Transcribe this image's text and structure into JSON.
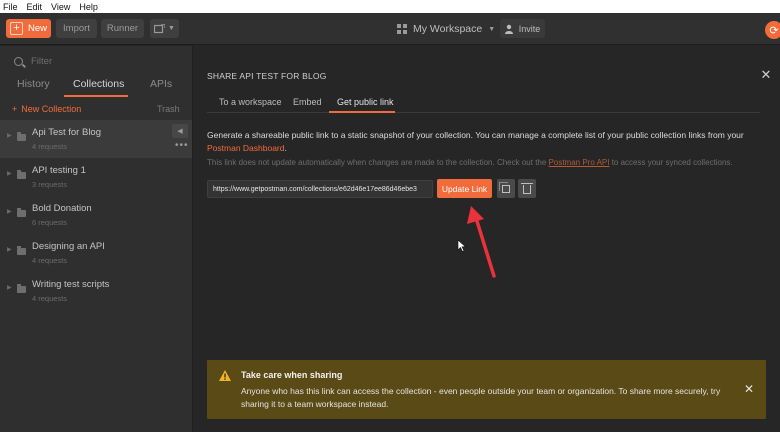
{
  "menu": [
    "File",
    "Edit",
    "View",
    "Help"
  ],
  "toolbar": {
    "new_label": "New",
    "import_label": "Import",
    "runner_label": "Runner",
    "workspace_label": "My Workspace",
    "invite_label": "Invite"
  },
  "sidebar": {
    "filter_placeholder": "Filter",
    "tabs": [
      "History",
      "Collections",
      "APIs"
    ],
    "new_collection_label": "New Collection",
    "trash_label": "Trash",
    "collections": [
      {
        "name": "Api Test for Blog",
        "count": "4 requests"
      },
      {
        "name": "API testing 1",
        "count": "3 requests"
      },
      {
        "name": "Bold Donation",
        "count": "6 requests"
      },
      {
        "name": "Designing an API",
        "count": "4 requests"
      },
      {
        "name": "Writing test scripts",
        "count": "4 requests"
      }
    ]
  },
  "modal": {
    "title": "SHARE API TEST FOR BLOG",
    "tabs": [
      "To a workspace",
      "Embed",
      "Get public link"
    ],
    "description": "Generate a shareable public link to a static snapshot of your collection. You can manage a complete list of your public collection links from your ",
    "description_link": "Postman Dashboard",
    "description_end": ".",
    "note_prefix": "This link does not update automatically when changes are made to the collection. Check out the ",
    "note_link": "Postman Pro API",
    "note_suffix": " to access your synced collections.",
    "url_value": "https://www.getpostman.com/collections/e62d46e17ee86d46ebe3",
    "update_label": "Update Link"
  },
  "warning": {
    "title": "Take care when sharing",
    "body": "Anyone who has this link can access the collection - even people outside your team or organization. To share more securely, try sharing it to a team workspace instead."
  },
  "colors": {
    "accent": "#f26b3a",
    "warning_bg": "#5a4a16",
    "annotation_arrow": "#e8323c"
  }
}
